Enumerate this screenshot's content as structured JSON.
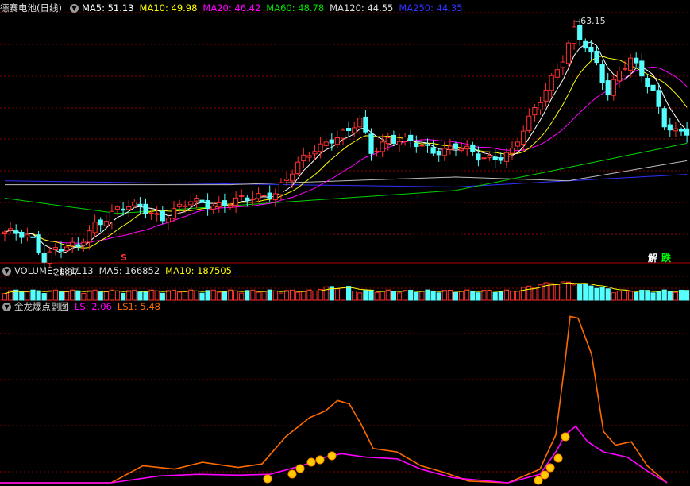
{
  "main_panel": {
    "title": "德赛电池(日线)",
    "indicators": [
      {
        "label": "MA5: 51.13",
        "color": "#ffffff"
      },
      {
        "label": "MA10: 49.98",
        "color": "#ffff00"
      },
      {
        "label": "MA20: 46.42",
        "color": "#ff00ff"
      },
      {
        "label": "MA60: 48.78",
        "color": "#00e000"
      },
      {
        "label": "MA120: 44.55",
        "color": "#dddddd"
      },
      {
        "label": "MA250: 44.35",
        "color": "#3030ff"
      }
    ],
    "high_label": "63.15",
    "low_label": "28.37",
    "signal_s": "S",
    "badge_jie": "解",
    "badge_die": "跌"
  },
  "volume_panel": {
    "indicators": [
      {
        "label": "VOLUME: 181113",
        "color": "#dddddd"
      },
      {
        "label": "MA5: 166852",
        "color": "#dddddd"
      },
      {
        "label": "MA10: 187505",
        "color": "#ffff00"
      }
    ]
  },
  "sub_panel": {
    "title": "金龙爆点副图",
    "indicators": [
      {
        "label": "LS: 2.06",
        "color": "#ff00ff"
      },
      {
        "label": "LS1: 5.48",
        "color": "#ff6a00"
      }
    ]
  },
  "colors": {
    "up": "#ff3030",
    "down": "#54ffff",
    "grid": "#8a0000",
    "ls1": "#ff6a00",
    "ls": "#ff00ff"
  },
  "chart_data": [
    {
      "type": "candlestick",
      "price_range": [
        26.5,
        65.5
      ],
      "overlays": [
        "MA5",
        "MA10",
        "MA20",
        "MA60",
        "MA120",
        "MA250"
      ]
    },
    {
      "type": "bar",
      "series": [
        {
          "name": "VOLUME"
        },
        {
          "name": "MA5"
        },
        {
          "name": "MA10"
        }
      ]
    },
    {
      "type": "line",
      "series": [
        {
          "name": "LS"
        },
        {
          "name": "LS1"
        }
      ]
    }
  ]
}
